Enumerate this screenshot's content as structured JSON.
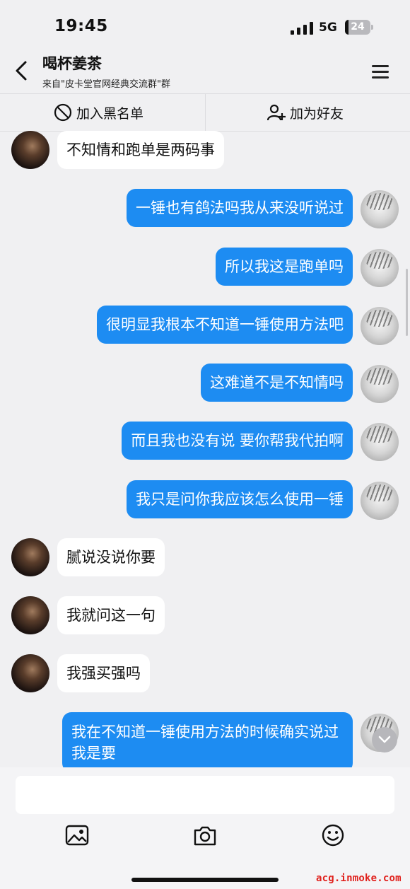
{
  "status": {
    "time": "19:45",
    "network": "5G",
    "battery": "24"
  },
  "header": {
    "title": "喝杯姜茶",
    "subtitle": "来自\"皮卡堂官网经典交流群\"群"
  },
  "actions": {
    "blacklist": "加入黑名单",
    "add_friend": "加为好友"
  },
  "messages": [
    {
      "side": "left",
      "text": "不知情和跑单是两码事"
    },
    {
      "side": "right",
      "text": "一锤也有鸽法吗我从来没听说过"
    },
    {
      "side": "right",
      "text": "所以我这是跑单吗"
    },
    {
      "side": "right",
      "text": "很明显我根本不知道一锤使用方法吧"
    },
    {
      "side": "right",
      "text": "这难道不是不知情吗"
    },
    {
      "side": "right",
      "text": "而且我也没有说 要你帮我代拍啊"
    },
    {
      "side": "right",
      "text": "我只是问你我应该怎么使用一锤"
    },
    {
      "side": "left",
      "text": "腻说没说你要"
    },
    {
      "side": "left",
      "text": "我就问这一句"
    },
    {
      "side": "left",
      "text": "我强买强吗"
    },
    {
      "side": "right",
      "text": "我在不知道一锤使用方法的时候确实说过我是要"
    }
  ],
  "composer": {
    "placeholder": ""
  },
  "watermark": "acg.inmoke.com",
  "colors": {
    "bubble_self": "#1d8cf2",
    "bubble_other": "#ffffff",
    "background": "#f0f0f2"
  },
  "icons": [
    "back-chevron-icon",
    "menu-icon",
    "ban-icon",
    "add-user-icon",
    "image-icon",
    "camera-icon",
    "emoji-icon",
    "scroll-down-chevron-icon"
  ]
}
